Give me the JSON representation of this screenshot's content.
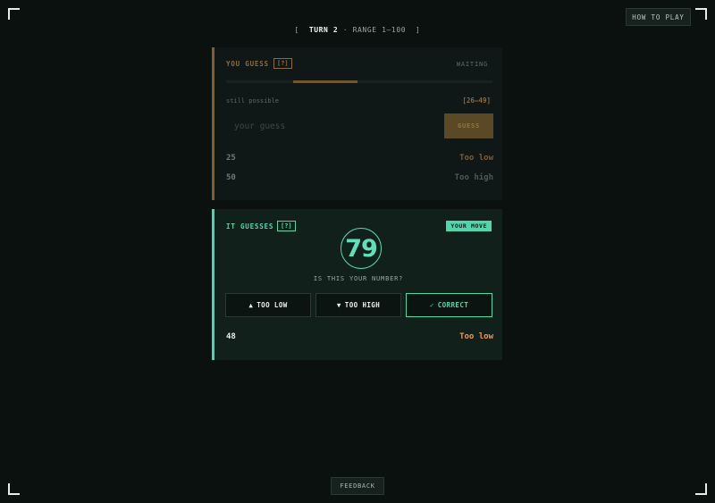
{
  "header": {
    "how_to_play": "HOW TO PLAY",
    "bracket_open": "[",
    "turn": "TURN 2",
    "sep": "·",
    "range": "RANGE 1–100",
    "bracket_close": "]"
  },
  "you_panel": {
    "title": "YOU GUESS",
    "help": "[?]",
    "status": "WAITING",
    "still_label": "still possible",
    "still_range": "[26–49]",
    "possible_range": {
      "low": 26,
      "high": 49,
      "min": 1,
      "max": 100
    },
    "input_placeholder": "your guess",
    "guess_button": "GUESS",
    "history": [
      {
        "num": "25",
        "result": "Too low",
        "color": "#7a5e38"
      },
      {
        "num": "50",
        "result": "Too high",
        "color": "#4d5955"
      }
    ]
  },
  "it_panel": {
    "title": "IT GUESSES",
    "help": "[?]",
    "badge": "YOUR MOVE",
    "current_guess": "79",
    "prompt": "IS THIS YOUR NUMBER?",
    "buttons": {
      "too_low_icon": "▲",
      "too_low": "TOO LOW",
      "too_high_icon": "▼",
      "too_high": "TOO HIGH",
      "correct_icon": "✓",
      "correct": "CORRECT"
    },
    "history": [
      {
        "num": "48",
        "result": "Too low"
      }
    ]
  },
  "footer": {
    "feedback": "FEEDBACK"
  },
  "colors": {
    "accent_you": "#8a5a2b",
    "accent_it": "#45d8ae",
    "too_low": "#e89a5c"
  }
}
